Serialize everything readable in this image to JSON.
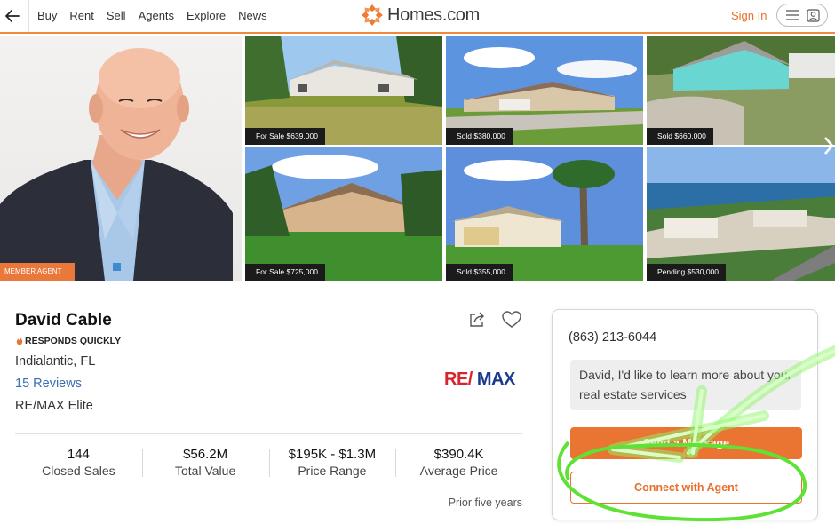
{
  "header": {
    "nav": [
      "Buy",
      "Rent",
      "Sell",
      "Agents",
      "Explore",
      "News"
    ],
    "logo_text": "Homes.com",
    "sign_in": "Sign In"
  },
  "agent": {
    "badge": "MEMBER AGENT",
    "name": "David Cable",
    "responds": "RESPONDS QUICKLY",
    "location": "Indialantic, FL",
    "reviews": "15 Reviews",
    "brokerage": "RE/MAX Elite",
    "brokerage_logo": "RE/MAX"
  },
  "listings": [
    {
      "label": "For Sale $639,000"
    },
    {
      "label": "Sold $380,000"
    },
    {
      "label": "Sold $660,000"
    },
    {
      "label": "For Sale $725,000"
    },
    {
      "label": "Sold $355,000"
    },
    {
      "label": "Pending $530,000"
    }
  ],
  "stats": [
    {
      "value": "144",
      "label": "Closed Sales"
    },
    {
      "value": "$56.2M",
      "label": "Total Value"
    },
    {
      "value": "$195K - $1.3M",
      "label": "Price Range"
    },
    {
      "value": "$390.4K",
      "label": "Average Price"
    }
  ],
  "stats_note": "Prior five years",
  "contact": {
    "phone": "(863) 213-6044",
    "message": "David, I'd like to learn more about your real estate services",
    "send_label": "Send a Message",
    "connect_label": "Connect with Agent"
  },
  "colors": {
    "accent": "#ea7532",
    "link": "#3a6fb0",
    "annotation": "#39e01a"
  },
  "icons": [
    "back-arrow-icon",
    "homes-logo-icon",
    "menu-icon",
    "user-icon",
    "chevron-right-icon",
    "share-icon",
    "heart-icon",
    "flame-icon"
  ]
}
